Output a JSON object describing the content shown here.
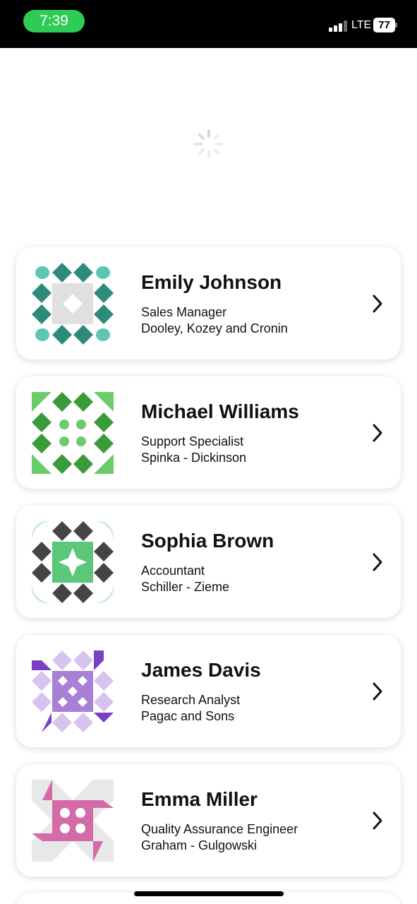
{
  "status_bar": {
    "time": "7:39",
    "network": "LTE",
    "battery": "77",
    "signal_bars_active": 3,
    "signal_bars_total": 4
  },
  "loading_spinner": {
    "icon": "loading-spinner-icon"
  },
  "users": [
    {
      "name": "Emily Johnson",
      "title": "Sales Manager",
      "company": "Dooley, Kozey and Cronin",
      "avatar_colors": {
        "primary": "#2e8b7a",
        "secondary": "#5cc6b4",
        "center": "#e0e0e0"
      }
    },
    {
      "name": "Michael Williams",
      "title": "Support Specialist",
      "company": "Spinka - Dickinson",
      "avatar_colors": {
        "primary": "#3a9b3a",
        "secondary": "#6ccc6c"
      }
    },
    {
      "name": "Sophia Brown",
      "title": "Accountant",
      "company": "Schiller - Zieme",
      "avatar_colors": {
        "primary": "#444444",
        "secondary": "#5cc67a",
        "light": "#bfe8c8"
      }
    },
    {
      "name": "James Davis",
      "title": "Research Analyst",
      "company": "Pagac and Sons",
      "avatar_colors": {
        "primary": "#7a3fc4",
        "secondary": "#a880d6",
        "light": "#d6c4ee"
      }
    },
    {
      "name": "Emma Miller",
      "title": "Quality Assurance Engineer",
      "company": "Graham - Gulgowski",
      "avatar_colors": {
        "primary": "#d46aa8",
        "secondary": "#e8e8e8"
      }
    }
  ]
}
